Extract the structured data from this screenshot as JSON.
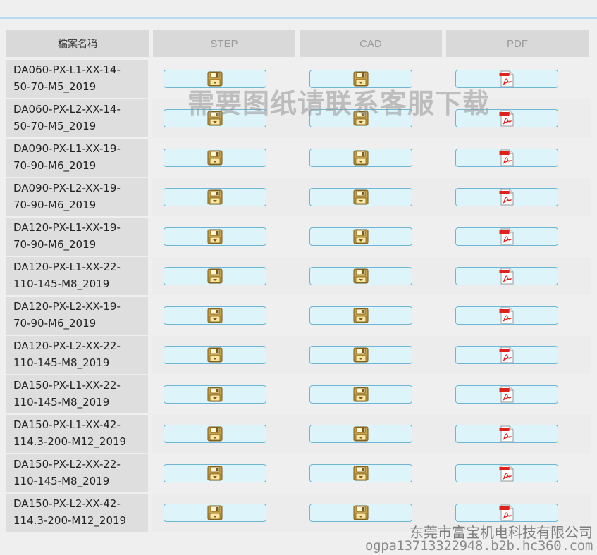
{
  "table": {
    "headers": {
      "name": "檔案名稱",
      "step": "STEP",
      "cad": "CAD",
      "pdf": "PDF"
    },
    "rows": [
      {
        "line1": "DA060-PX-L1-XX-14-",
        "line2": "50-70-M5_2019"
      },
      {
        "line1": "DA060-PX-L2-XX-14-",
        "line2": "50-70-M5_2019"
      },
      {
        "line1": "DA090-PX-L1-XX-19-",
        "line2": "70-90-M6_2019"
      },
      {
        "line1": "DA090-PX-L2-XX-19-",
        "line2": "70-90-M6_2019"
      },
      {
        "line1": "DA120-PX-L1-XX-19-",
        "line2": "70-90-M6_2019"
      },
      {
        "line1": "DA120-PX-L1-XX-22-",
        "line2": "110-145-M8_2019"
      },
      {
        "line1": "DA120-PX-L2-XX-19-",
        "line2": "70-90-M6_2019"
      },
      {
        "line1": "DA120-PX-L2-XX-22-",
        "line2": "110-145-M8_2019"
      },
      {
        "line1": "DA150-PX-L1-XX-22-",
        "line2": "110-145-M8_2019"
      },
      {
        "line1": "DA150-PX-L1-XX-42-",
        "line2": "114.3-200-M12_2019"
      },
      {
        "line1": "DA150-PX-L2-XX-22-",
        "line2": "110-145-M8_2019"
      },
      {
        "line1": "DA150-PX-L2-XX-42-",
        "line2": "114.3-200-M12_2019"
      }
    ]
  },
  "icons": {
    "step": "floppy-disk-icon",
    "cad": "floppy-disk-icon",
    "pdf": "pdf-file-icon"
  },
  "colors": {
    "button_bg": "#ddf4fb",
    "button_border": "#6fb6d6",
    "top_rule": "#b9d9ee",
    "pdf_red": "#e0201b"
  },
  "watermark": "需要图纸请联系客服下载",
  "footer": {
    "company": "东莞市富宝机电科技有限公司",
    "url": "ogpa13713322948.b2b.hc360.com"
  }
}
